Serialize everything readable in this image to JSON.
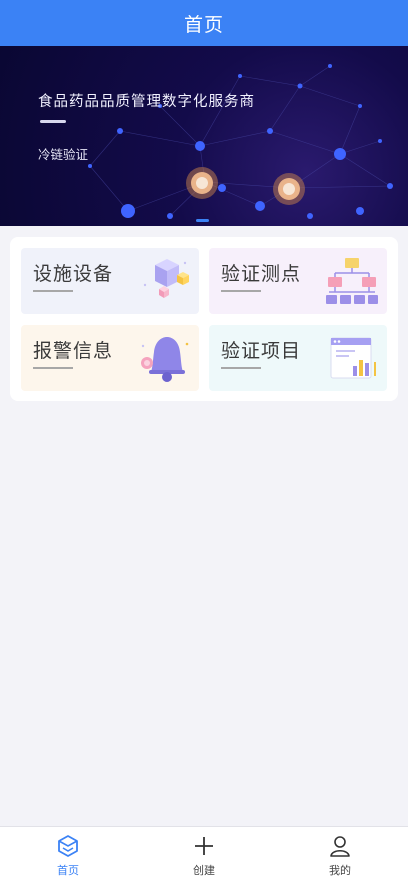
{
  "header": {
    "title": "首页"
  },
  "banner": {
    "title": "食品药品品质管理数字化服务商",
    "subtitle": "冷链验证",
    "slides_total": 1,
    "active_slide": 1
  },
  "tiles": [
    {
      "label": "设施设备",
      "icon": "cubes-icon"
    },
    {
      "label": "验证测点",
      "icon": "hierarchy-chart-icon"
    },
    {
      "label": "报警信息",
      "icon": "bell-icon"
    },
    {
      "label": "验证项目",
      "icon": "report-chart-icon"
    }
  ],
  "tabbar": {
    "items": [
      {
        "label": "首页",
        "icon": "home-cube-icon",
        "active": true
      },
      {
        "label": "创建",
        "icon": "plus-icon",
        "active": false
      },
      {
        "label": "我的",
        "icon": "user-icon",
        "active": false
      }
    ]
  },
  "colors": {
    "accent": "#3b82f5",
    "banner_bg": "#0f0a40"
  }
}
